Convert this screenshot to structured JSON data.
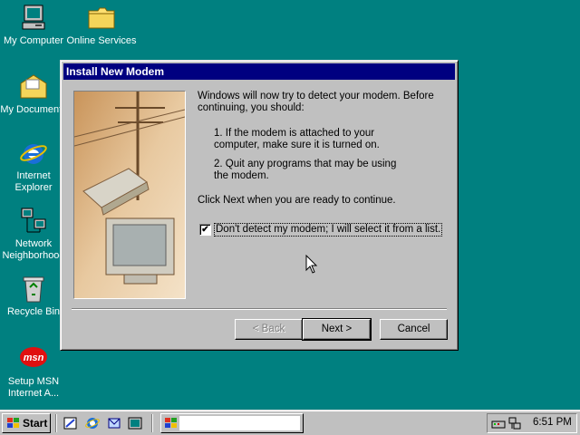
{
  "desktop": {
    "icons": [
      {
        "label": "My Computer"
      },
      {
        "label": "Online Services"
      },
      {
        "label": "My Documents"
      },
      {
        "label": "Internet Explorer"
      },
      {
        "label": "Network Neighborhood"
      },
      {
        "label": "Recycle Bin"
      },
      {
        "label": "Setup MSN Internet A..."
      }
    ]
  },
  "dialog": {
    "title": "Install New Modem",
    "intro": "Windows will now try to detect your modem.  Before continuing, you should:",
    "step1": "1.  If the modem is attached to your computer, make sure it is turned on.",
    "step2": "2.  Quit any programs that may be using the modem.",
    "instruction": "Click Next when you are ready to continue.",
    "checkbox_label": "Don't detect my modem; I will select it from a list.",
    "checkbox_checked": true,
    "check_mark": "✔",
    "back_label": "< Back",
    "next_label": "Next >",
    "cancel_label": "Cancel"
  },
  "taskbar": {
    "start_label": "Start",
    "clock": "6:51 PM"
  },
  "msn_logo_text": "msn",
  "colors": {
    "desktop": "#008080",
    "titlebar": "#000080",
    "face": "#c0c0c0"
  }
}
